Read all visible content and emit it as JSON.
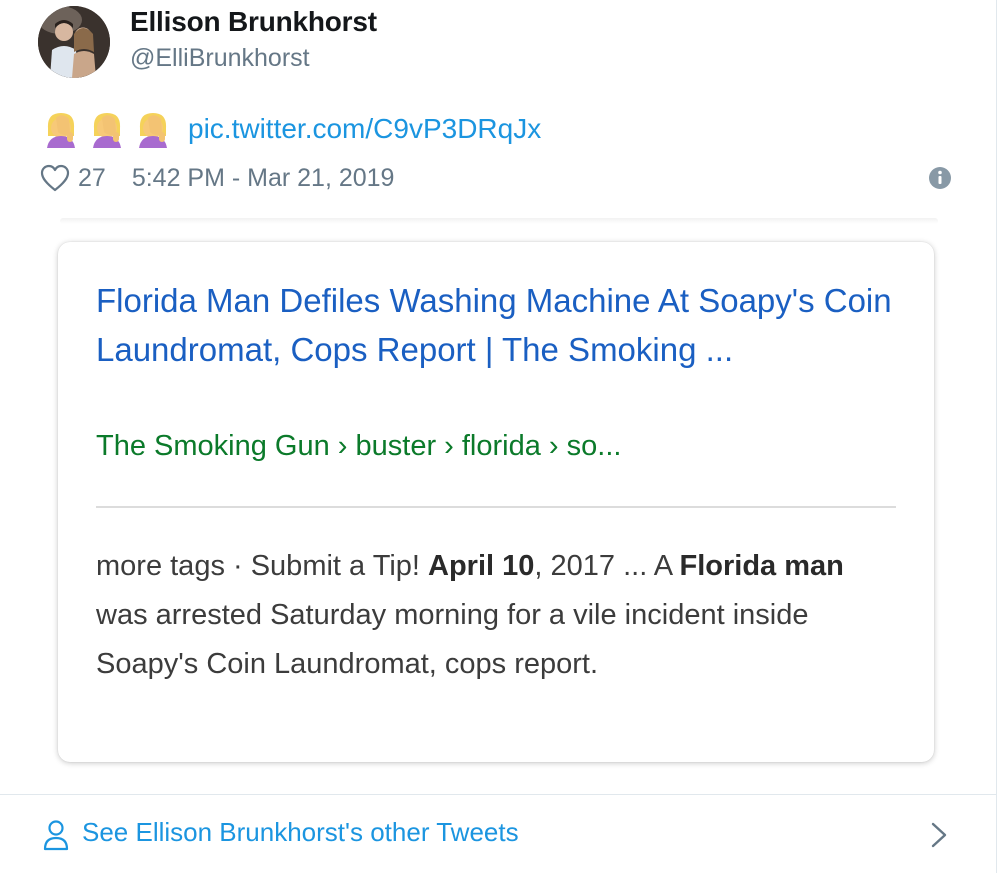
{
  "tweet": {
    "author": {
      "display_name": "Ellison Brunkhorst",
      "handle": "@ElliBrunkhorst"
    },
    "emojis": [
      "facepalm-icon",
      "facepalm-icon",
      "facepalm-icon"
    ],
    "link_text": "pic.twitter.com/C9vP3DRqJx",
    "like_count": "27",
    "timestamp": "5:42 PM - Mar 21, 2019"
  },
  "search_result": {
    "title": "Florida Man Defiles Washing Machine At Soapy's Coin Laundromat, Cops Report | The Smoking ...",
    "url_crumbs": "The Smoking Gun › buster › florida › so...",
    "snippet": {
      "part1": "more tags · Submit a Tip! ",
      "bold_date": "April 10",
      "part2": ", 2017 ... A ",
      "bold_phrase": "Florida man",
      "part3": " was arrested Saturday morning for a vile incident inside Soapy's Coin Laundromat, cops report."
    }
  },
  "footer": {
    "other_tweets_label": "See Ellison Brunkhorst's other Tweets"
  },
  "colors": {
    "link_blue": "#1b95e0",
    "result_title_blue": "#1a5fc2",
    "result_url_green": "#0b7a2a",
    "muted_gray": "#657786"
  }
}
